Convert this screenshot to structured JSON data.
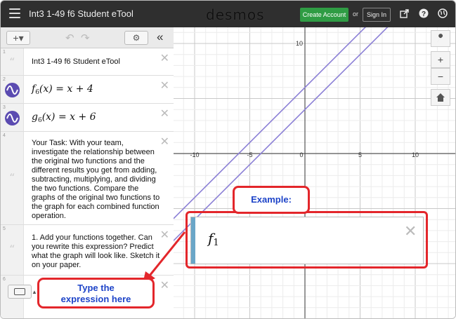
{
  "header": {
    "doc_title": "Int3 1-49 f6 Student eTool",
    "brand": "desmos",
    "create_account": "Create Account",
    "or": "or",
    "sign_in": "Sign In"
  },
  "sidebar": {
    "add_label": "+▾",
    "gear": "⚙",
    "collapse": "«",
    "expressions": [
      {
        "num": "1",
        "text": "Int3 1-49 f6 Student eTool"
      },
      {
        "num": "2",
        "fn": "f",
        "sub": "6",
        "rest": "(x) = x + 4"
      },
      {
        "num": "3",
        "fn": "g",
        "sub": "6",
        "rest": "(x) = x + 6"
      },
      {
        "num": "4",
        "text": "Your Task: With your team, investigate the relationship between the original two functions and the different results you get from adding, subtracting, multiplying, and dividing the two functions. Compare the graphs of the original two functions to the graph for each combined function operation."
      },
      {
        "num": "5",
        "text": "1. Add your functions together. Can you rewrite this expression? Predict what the graph will look like. Sketch it on your paper."
      },
      {
        "num": "6"
      }
    ]
  },
  "graph": {
    "x_ticks": [
      "-10",
      "-5",
      "0",
      "5",
      "10"
    ],
    "y_ticks": [
      "10"
    ],
    "lines": [
      {
        "slope": 1,
        "intercept": 4,
        "color": "#8b7fd6"
      },
      {
        "slope": 1,
        "intercept": 6,
        "color": "#8b7fd6"
      }
    ]
  },
  "callouts": {
    "example": "Example:",
    "example_fn": "f",
    "example_sub": "1",
    "type_line1": "Type the",
    "type_line2": "expression here"
  },
  "colors": {
    "topbar": "#2f2f2f",
    "create": "#2f9c44",
    "callout_border": "#e3262b",
    "callout_text": "#1e44c8"
  }
}
